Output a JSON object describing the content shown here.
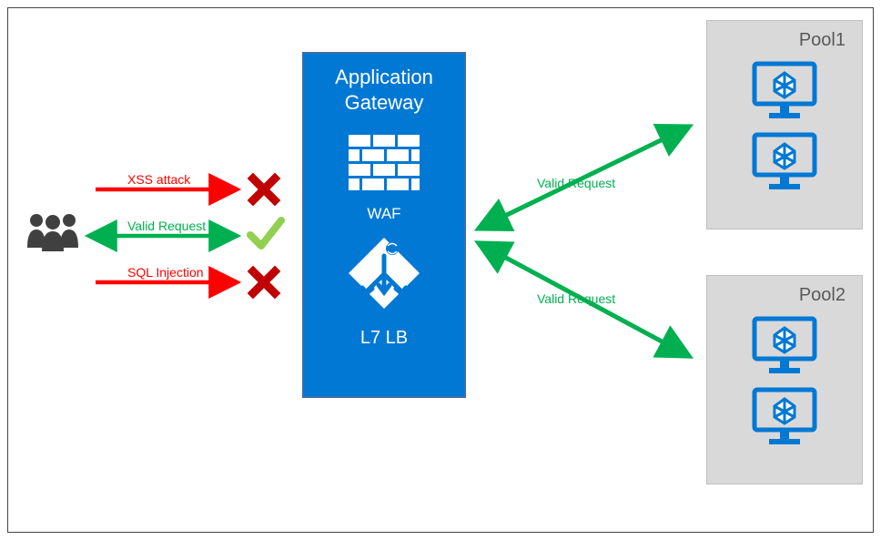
{
  "gateway": {
    "title_line1": "Application",
    "title_line2": "Gateway",
    "waf_label": "WAF",
    "lb_label": "L7 LB"
  },
  "requests": {
    "xss": "XSS attack",
    "valid": "Valid Request",
    "sql": "SQL Injection",
    "valid_out_top": "Valid Request",
    "valid_out_bottom": "Valid Request"
  },
  "pools": {
    "pool1_title": "Pool1",
    "pool2_title": "Pool2"
  },
  "colors": {
    "azure_blue": "#0078d4",
    "green": "#00b050",
    "red": "#ff0000",
    "dark_red": "#c00000",
    "grey": "#595959",
    "box_grey": "#d9d9d9"
  }
}
